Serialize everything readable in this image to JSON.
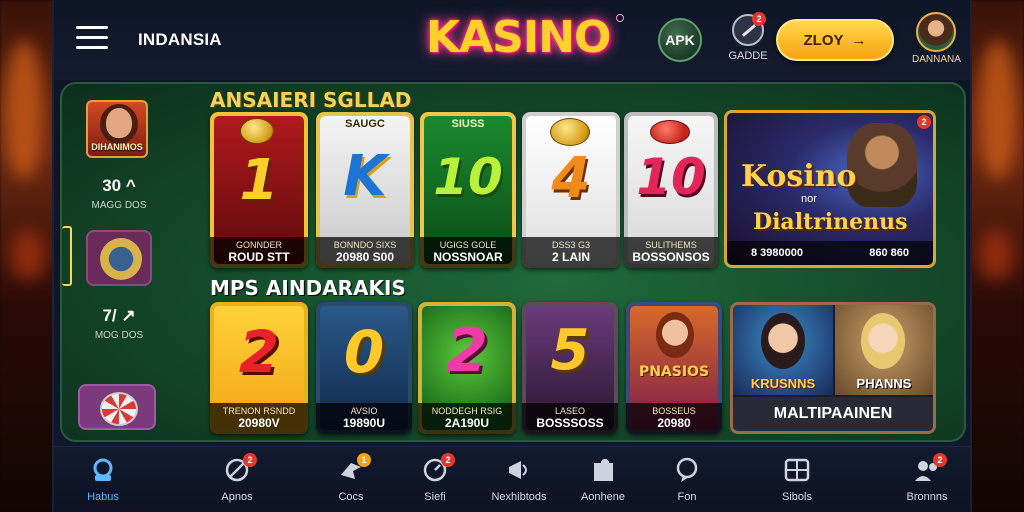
{
  "header": {
    "brand_left": "INDANSIA",
    "logo": "KASINO",
    "apk_label": "APK",
    "icon_label": "GADDE",
    "icon_badge": "2",
    "play_label": "ZLOY",
    "play_arrow": "→",
    "avatar_label": "DANNANA"
  },
  "sidebar": {
    "avatar_caption": "DIHANIMOS",
    "stat1_value": "30 ^",
    "stat1_label": "MAGG DOS",
    "stat2_value": "7/ ↗",
    "stat2_label": "MOG DOS"
  },
  "sections": {
    "top_title": "ANSAIERI SGLLAD",
    "bottom_title": "MPS AINDARAKIS"
  },
  "top_tiles": [
    {
      "top": "",
      "big": "1",
      "line1": "GONNDER",
      "line2": "ROUD STT"
    },
    {
      "top": "SAUGC",
      "big": "K",
      "line1": "BONNDO SIXS",
      "line2": "20980 S00"
    },
    {
      "top": "SIUSS",
      "big": "10",
      "line1": "UGIGS GOLE",
      "line2": "NOSSNOAR"
    },
    {
      "top": "",
      "big": "4",
      "line1": "DSS3 G3",
      "line2": "2 LAIN"
    },
    {
      "top": "",
      "big": "10",
      "line1": "SULITHEMS",
      "line2": "BOSSONSOS"
    }
  ],
  "promo_top": {
    "title1": "Kosino",
    "title2": "Dialtrinenus",
    "subtitle": "nor",
    "footer_left": "8 3980000",
    "footer_right": "860 860",
    "badge": "2"
  },
  "bottom_tiles": [
    {
      "big": "2",
      "line1": "TRENON RSNDD",
      "line2": "20980V"
    },
    {
      "big": "0",
      "line1": "AVSIO",
      "line2": "19890U"
    },
    {
      "big": "2",
      "line1": "NODDEGH RSIG",
      "line2": "2A190U"
    },
    {
      "big": "5",
      "line1": "LASEO",
      "line2": "BOSSSOSS"
    }
  ],
  "bottom_cards": [
    {
      "title": "PNASIOS",
      "line1": "BOSSEUS",
      "line2": "20980"
    }
  ],
  "multi_card": {
    "name_left": "KRUSNNS",
    "name_right": "PHANNS",
    "footer": "MALTIPAAINEN"
  },
  "bottom_nav": [
    {
      "label": "Habus",
      "icon": "home-icon",
      "badge": ""
    },
    {
      "label": "Apnos",
      "icon": "ban-icon",
      "badge": "2"
    },
    {
      "label": "Cocs",
      "icon": "bird-icon",
      "badge": "1"
    },
    {
      "label": "Siefi",
      "icon": "clock-icon",
      "badge": "2"
    },
    {
      "label": "Nexhibtods",
      "icon": "megaphone-icon",
      "badge": ""
    },
    {
      "label": "Aonhene",
      "icon": "puzzle-icon",
      "badge": ""
    },
    {
      "label": "Fon",
      "icon": "chat-icon",
      "badge": ""
    },
    {
      "label": "Sibols",
      "icon": "grid-icon",
      "badge": ""
    },
    {
      "label": "Bronnns",
      "icon": "user-icon",
      "badge": "2"
    }
  ],
  "colors": {
    "accent_gold": "#ffd12a",
    "table_green": "#1f6a3a",
    "active_nav": "#5fb7ff",
    "badge_red": "#e2372c"
  }
}
